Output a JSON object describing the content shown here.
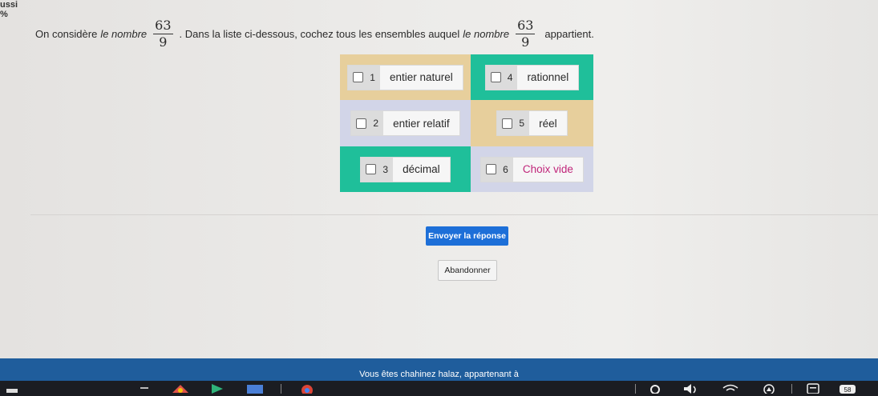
{
  "header": {
    "corner_text": "ussi",
    "corner_pct": "%"
  },
  "question": {
    "prefix": "On considère",
    "italic1": "le nombre",
    "fraction": {
      "numerator": "63",
      "denominator": "9"
    },
    "middle": ". Dans la liste ci-dessous, cochez tous les ensembles auquel",
    "italic2": "le nombre",
    "suffix": "appartient."
  },
  "options": [
    {
      "number": "1",
      "label": "entier naturel",
      "checked": false
    },
    {
      "number": "4",
      "label": "rationnel",
      "checked": false
    },
    {
      "number": "2",
      "label": "entier relatif",
      "checked": false
    },
    {
      "number": "5",
      "label": "réel",
      "checked": false
    },
    {
      "number": "3",
      "label": "décimal",
      "checked": false
    },
    {
      "number": "6",
      "label": "Choix vide",
      "checked": false
    }
  ],
  "buttons": {
    "send": "Envoyer la réponse",
    "abandon": "Abandonner"
  },
  "footer": {
    "text": "Vous êtes chahinez halaz, appartenant à"
  },
  "colors": {
    "tan": "#e7cf9c",
    "teal": "#1fbf9a",
    "lavender": "#d2d5e8",
    "primary": "#1d6fd8",
    "choix_vide": "#c0257a"
  },
  "taskbar": {
    "battery_label": "58"
  }
}
